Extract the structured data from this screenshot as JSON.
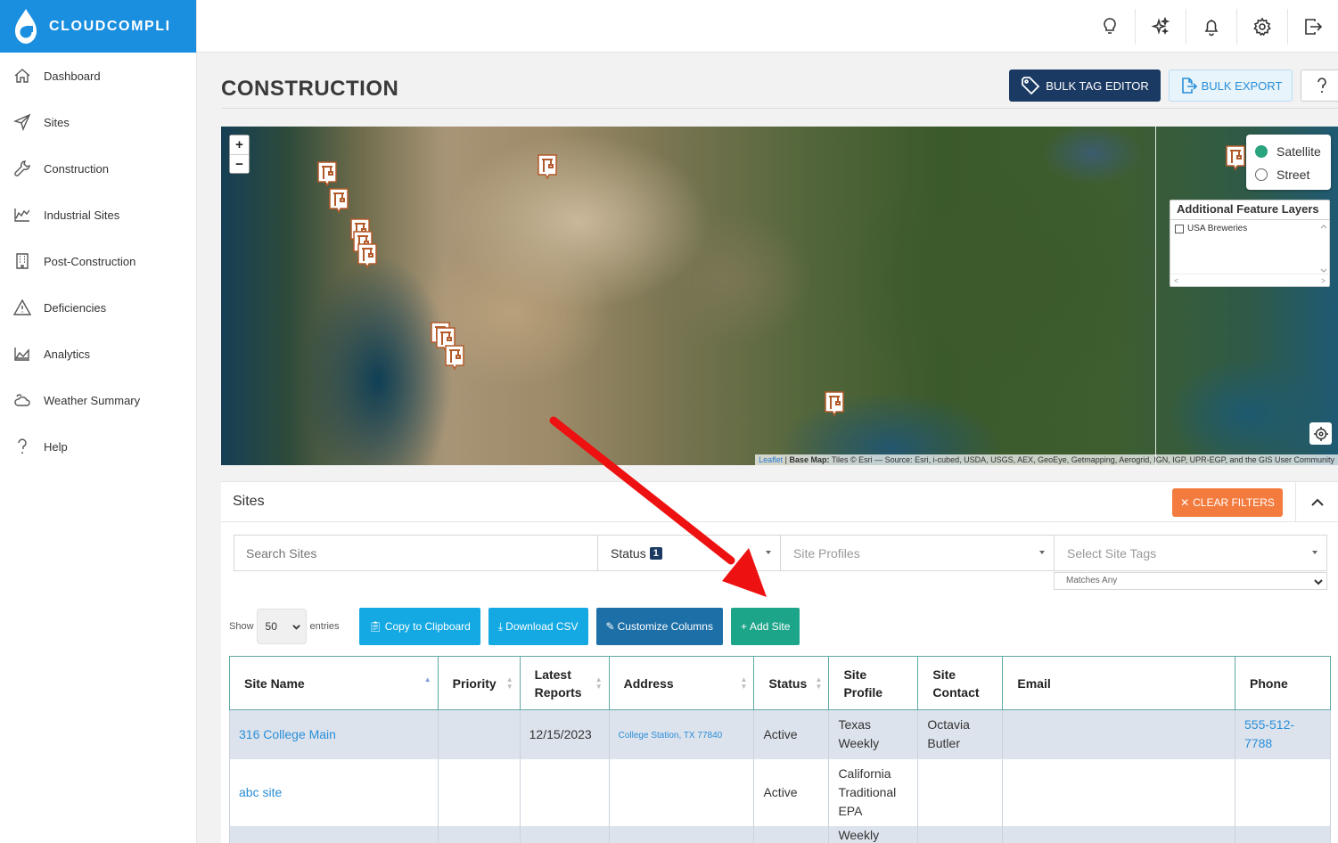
{
  "brand": {
    "name": "CLOUDCOMPLI"
  },
  "sidebar": {
    "items": [
      {
        "label": "Dashboard",
        "icon": "home-icon"
      },
      {
        "label": "Sites",
        "icon": "send-icon"
      },
      {
        "label": "Construction",
        "icon": "wrench-icon"
      },
      {
        "label": "Industrial Sites",
        "icon": "factory-icon"
      },
      {
        "label": "Post-Construction",
        "icon": "building-icon"
      },
      {
        "label": "Deficiencies",
        "icon": "warning-icon"
      },
      {
        "label": "Analytics",
        "icon": "chart-icon"
      },
      {
        "label": "Weather Summary",
        "icon": "weather-icon"
      },
      {
        "label": "Help",
        "icon": "question-icon"
      }
    ]
  },
  "topbar": {
    "icons": [
      "lightbulb-icon",
      "sparkle-icon",
      "bell-icon",
      "gear-icon",
      "logout-icon"
    ]
  },
  "page": {
    "title": "CONSTRUCTION",
    "bulk_tag_label": "BULK TAG EDITOR",
    "bulk_export_label": "BULK EXPORT"
  },
  "map": {
    "zoom_in": "+",
    "zoom_out": "−",
    "layers": [
      {
        "label": "Satellite",
        "selected": true
      },
      {
        "label": "Street",
        "selected": false
      }
    ],
    "feature_layers_title": "Additional Feature Layers",
    "feature_layers": [
      {
        "label": "USA Breweries",
        "checked": false
      }
    ],
    "attribution_leaflet": "Leaflet",
    "attribution_basemap": "Base Map:",
    "attribution_text": "Tiles © Esri — Source: Esri, i-cubed, USDA, USGS, AEX, GeoEye, Getmapping, Aerogrid, IGN, IGP, UPR-EGP, and the GIS User Community"
  },
  "sites": {
    "panel_title": "Sites",
    "clear_filters_label": "CLEAR FILTERS",
    "search_placeholder": "Search Sites",
    "status_label": "Status",
    "status_count": "1",
    "site_profiles_placeholder": "Site Profiles",
    "site_tags_placeholder": "Select Site Tags",
    "matches_label": "Matches Any",
    "show_label": "Show",
    "entries_value": "50",
    "entries_label": "entries",
    "copy_label": "Copy to Clipboard",
    "csv_label": "Download CSV",
    "customize_label": "Customize Columns",
    "add_label": "Add Site",
    "columns": [
      "Site Name",
      "Priority",
      "Latest Reports",
      "Address",
      "Status",
      "Site Profile",
      "Site Contact",
      "Email",
      "Phone"
    ],
    "rows": [
      {
        "name": "316 College Main",
        "priority": "",
        "latest": "12/15/2023",
        "address": "College Station, TX 77840",
        "status": "Active",
        "profile": "Texas Weekly",
        "contact": "Octavia Butler",
        "email": "",
        "phone": "555-512-7788"
      },
      {
        "name": "abc site",
        "priority": "",
        "latest": "",
        "address": "",
        "status": "Active",
        "profile": "California Traditional EPA",
        "contact": "",
        "email": "",
        "phone": ""
      },
      {
        "name": "",
        "priority": "",
        "latest": "",
        "address": "",
        "status": "",
        "profile": "Weekly",
        "contact": "",
        "email": "",
        "phone": ""
      }
    ]
  },
  "colors": {
    "brand": "#1a8fe0",
    "navy": "#1b3a63",
    "orange": "#f47b3e",
    "teal": "#1da58a",
    "annotation_arrow": "#ee1111"
  }
}
